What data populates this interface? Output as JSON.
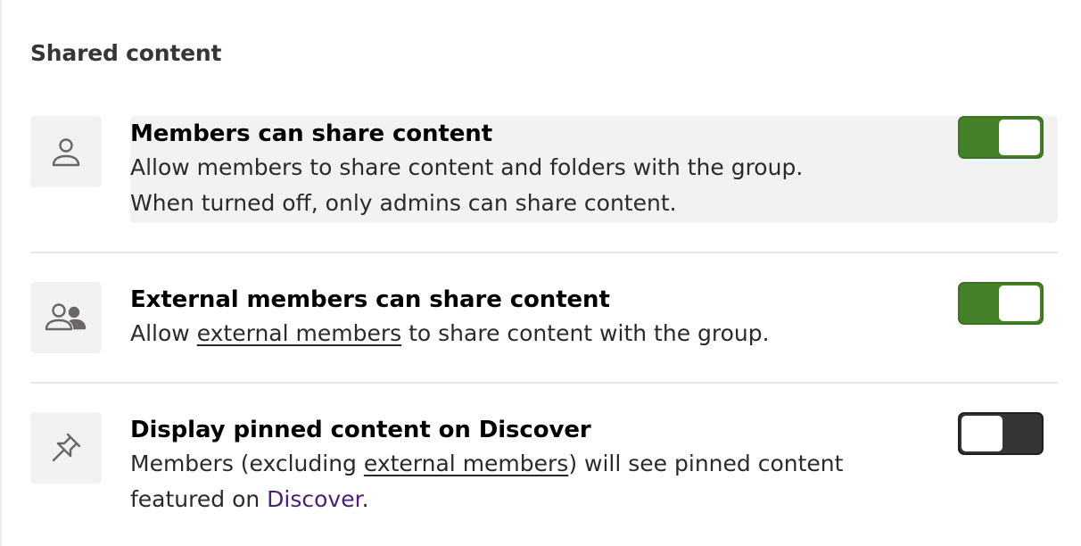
{
  "section": {
    "title": "Shared content"
  },
  "settings": [
    {
      "icon": "person-icon",
      "title": "Members can share content",
      "desc_line1": "Allow members to share content and folders with the group.",
      "desc_line2": "When turned off, only admins can share content.",
      "enabled": true
    },
    {
      "icon": "people-icon",
      "title": "External members can share content",
      "desc_pre": "Allow ",
      "desc_link": "external members",
      "desc_post": " to share content with the group.",
      "enabled": true
    },
    {
      "icon": "pin-icon",
      "title": "Display pinned content on Discover",
      "desc_pre": "Members (excluding ",
      "desc_link": "external members",
      "desc_mid": ") will see pinned content featured on ",
      "desc_link2": "Discover",
      "desc_post": ".",
      "enabled": false
    }
  ],
  "colors": {
    "toggle_on": "#45812a",
    "toggle_off": "#353535",
    "link_purple": "#4c1d7a"
  }
}
